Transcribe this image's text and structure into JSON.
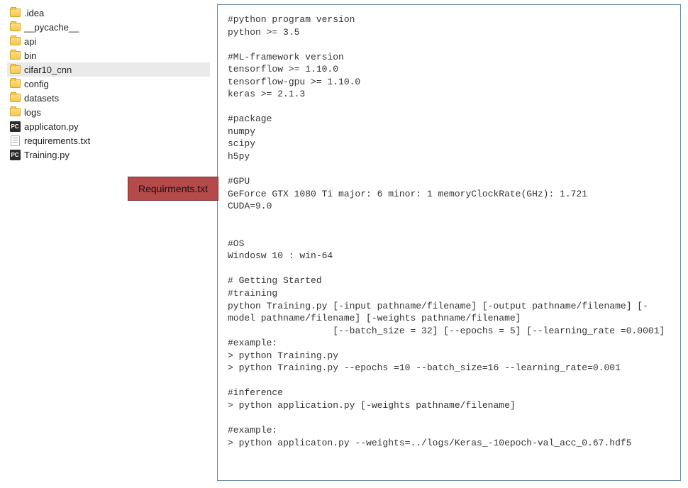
{
  "file_tree": {
    "items": [
      {
        "name": ".idea",
        "icon": "folder",
        "selected": false
      },
      {
        "name": "__pycache__",
        "icon": "folder",
        "selected": false
      },
      {
        "name": "api",
        "icon": "folder",
        "selected": false
      },
      {
        "name": "bin",
        "icon": "folder",
        "selected": false
      },
      {
        "name": "cifar10_cnn",
        "icon": "folder",
        "selected": true
      },
      {
        "name": "config",
        "icon": "folder",
        "selected": false
      },
      {
        "name": "datasets",
        "icon": "folder",
        "selected": false
      },
      {
        "name": "logs",
        "icon": "folder",
        "selected": false
      },
      {
        "name": "applicaton.py",
        "icon": "py",
        "selected": false
      },
      {
        "name": "requirements.txt",
        "icon": "txt",
        "selected": false
      },
      {
        "name": "Training.py",
        "icon": "py",
        "selected": false
      }
    ]
  },
  "annotation": {
    "label": "Requirments.txt"
  },
  "file_content": {
    "text": "#python program version\npython >= 3.5\n\n#ML-framework version\ntensorflow >= 1.10.0\ntensorflow-gpu >= 1.10.0\nkeras >= 2.1.3\n\n#package\nnumpy\nscipy\nh5py\n\n#GPU\nGeForce GTX 1080 Ti major: 6 minor: 1 memoryClockRate(GHz): 1.721\nCUDA=9.0\n\n\n#OS\nWindosw 10 : win-64\n\n# Getting Started\n#training\npython Training.py [-input pathname/filename] [-output pathname/filename] [-model pathname/filename] [-weights pathname/filename]\n                   [--batch_size = 32] [--epochs = 5] [--learning_rate =0.0001]\n#example:\n> python Training.py\n> python Training.py --epochs =10 --batch_size=16 --learning_rate=0.001\n\n#inference\n> python application.py [-weights pathname/filename]\n\n#example:\n> python applicaton.py --weights=../logs/Keras_-10epoch-val_acc_0.67.hdf5"
  },
  "icons": {
    "py_badge": "PC"
  }
}
